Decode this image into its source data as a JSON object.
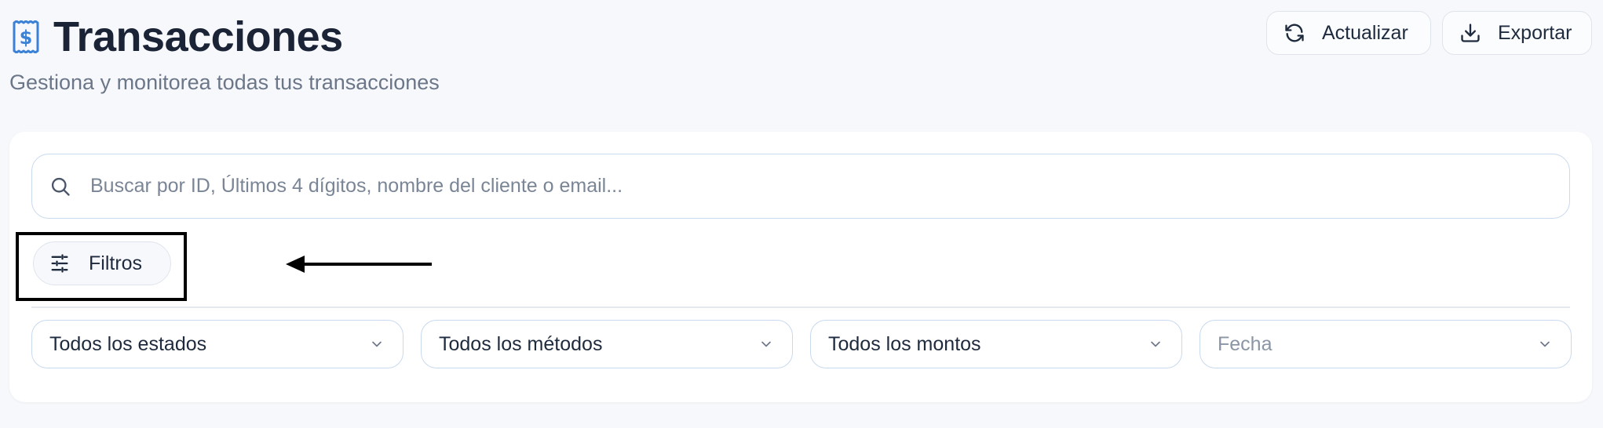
{
  "header": {
    "title": "Transacciones",
    "title_icon": "receipt-dollar-icon",
    "subtitle": "Gestiona y monitorea todas tus transacciones",
    "accent_color": "#3b82d6"
  },
  "actions": {
    "refresh_label": "Actualizar",
    "refresh_icon": "refresh-icon",
    "export_label": "Exportar",
    "export_icon": "download-icon"
  },
  "search": {
    "placeholder": "Buscar por ID, Últimos 4 dígitos, nombre del cliente o email...",
    "value": "",
    "icon": "search-icon"
  },
  "filters": {
    "button_label": "Filtros",
    "button_icon": "sliders-icon",
    "selects": [
      {
        "value": "Todos los estados",
        "is_placeholder": false
      },
      {
        "value": "Todos los métodos",
        "is_placeholder": false
      },
      {
        "value": "Todos los montos",
        "is_placeholder": false
      },
      {
        "value": "Fecha",
        "is_placeholder": true
      }
    ]
  },
  "annotation": {
    "highlight_color": "#000000",
    "arrow_direction": "left"
  }
}
